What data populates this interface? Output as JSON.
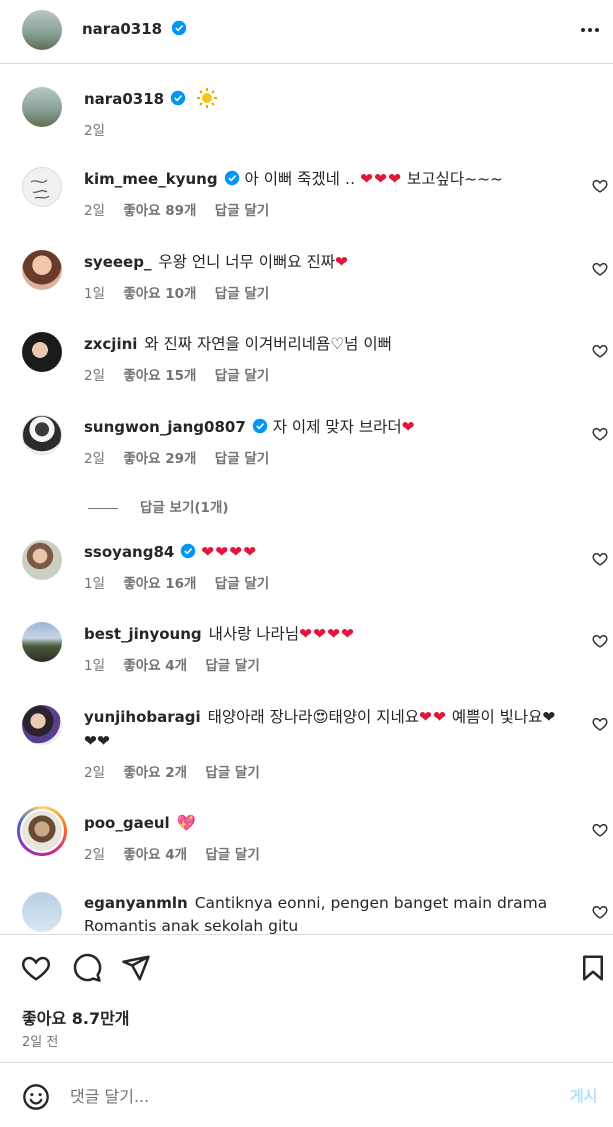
{
  "header": {
    "username": "nara0318",
    "more_icon": "more-horizontal-icon"
  },
  "caption": {
    "username": "nara0318",
    "emoji": "sun-icon",
    "age": "2일"
  },
  "comments": [
    {
      "username": "kim_mee_kyung",
      "verified": true,
      "text": "아 이뻐 죽겠네 ‥",
      "hearts": "❤❤❤",
      "text_after": " 보고싶다~~~",
      "age": "2일",
      "likes": "좋아요 89개",
      "reply": "답글 달기"
    },
    {
      "username": "syeeep_",
      "verified": false,
      "text": "우왕 언니 너무 이뻐요 진짜",
      "hearts": "❤",
      "text_after": "",
      "age": "1일",
      "likes": "좋아요 10개",
      "reply": "답글 달기"
    },
    {
      "username": "zxcjini",
      "verified": false,
      "text": "와 진짜 자연을 이겨버리네욤♡넘 이뻐",
      "hearts": "",
      "text_after": "",
      "age": "2일",
      "likes": "좋아요 15개",
      "reply": "답글 달기"
    },
    {
      "username": "sungwon_jang0807",
      "verified": true,
      "text": "자 이제 맞자 브라더",
      "hearts": "❤",
      "text_after": "",
      "age": "2일",
      "likes": "좋아요 29개",
      "reply": "답글 달기"
    },
    {
      "username": "ssoyang84",
      "verified": true,
      "text": "",
      "hearts": "❤❤❤❤",
      "text_after": "",
      "age": "1일",
      "likes": "좋아요 16개",
      "reply": "답글 달기"
    },
    {
      "username": "best_jinyoung",
      "verified": false,
      "text": "내사랑 나라님",
      "hearts": "❤❤❤❤",
      "text_after": "",
      "age": "1일",
      "likes": "좋아요 4개",
      "reply": "답글 달기"
    },
    {
      "username": "yunjihobaragi",
      "verified": false,
      "text": "태양아래 장나라😍태양이 지네요",
      "hearts": "❤❤",
      "text_after": " 예쁨이 빛나요❤❤❤",
      "age": "2일",
      "likes": "좋아요 2개",
      "reply": "답글 달기"
    },
    {
      "username": "poo_gaeul",
      "verified": false,
      "text": "",
      "hearts": "💖",
      "text_after": "",
      "age": "2일",
      "likes": "좋아요 4개",
      "reply": "답글 달기"
    },
    {
      "username": "eganyanmln",
      "verified": false,
      "text": "Cantiknya eonni, pengen banget main drama Romantis anak sekolah gitu",
      "hearts": "",
      "text_after": "",
      "age": "",
      "likes": "",
      "reply": ""
    }
  ],
  "view_replies": "답글 보기(1개)",
  "actions": {
    "likes": "좋아요 8.7만개",
    "time": "2일 전"
  },
  "composer": {
    "placeholder": "댓글 달기...",
    "post": "게시"
  },
  "colors": {
    "verified": "#0095f6",
    "heart": "#e0163a",
    "link_disabled": "#b2dffc"
  }
}
